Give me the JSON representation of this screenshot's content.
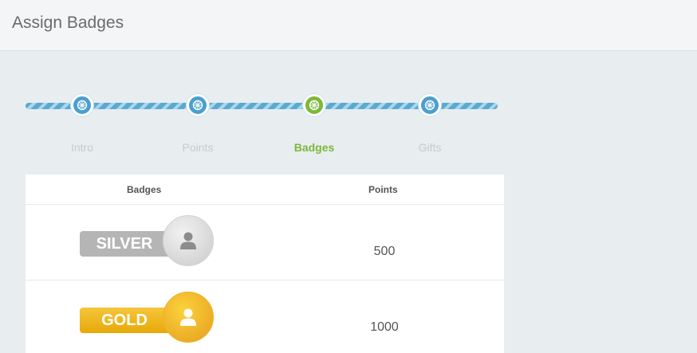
{
  "header": {
    "title": "Assign Badges"
  },
  "stepper": {
    "steps": [
      {
        "label": "Intro",
        "icon": "wheel-icon",
        "active": false
      },
      {
        "label": "Points",
        "icon": "wheel-icon",
        "active": false
      },
      {
        "label": "Badges",
        "icon": "wheel-icon",
        "active": true
      },
      {
        "label": "Gifts",
        "icon": "wheel-icon",
        "active": false
      }
    ]
  },
  "table": {
    "headers": {
      "badges": "Badges",
      "points": "Points"
    },
    "rows": [
      {
        "badge": "SILVER",
        "points": "500",
        "icon": "person-icon",
        "color": "#b5b5b5"
      },
      {
        "badge": "GOLD",
        "points": "1000",
        "icon": "person-icon",
        "color": "#efb90f"
      }
    ]
  },
  "colors": {
    "accent_blue": "#4a9fcf",
    "accent_green": "#7cb83a"
  }
}
